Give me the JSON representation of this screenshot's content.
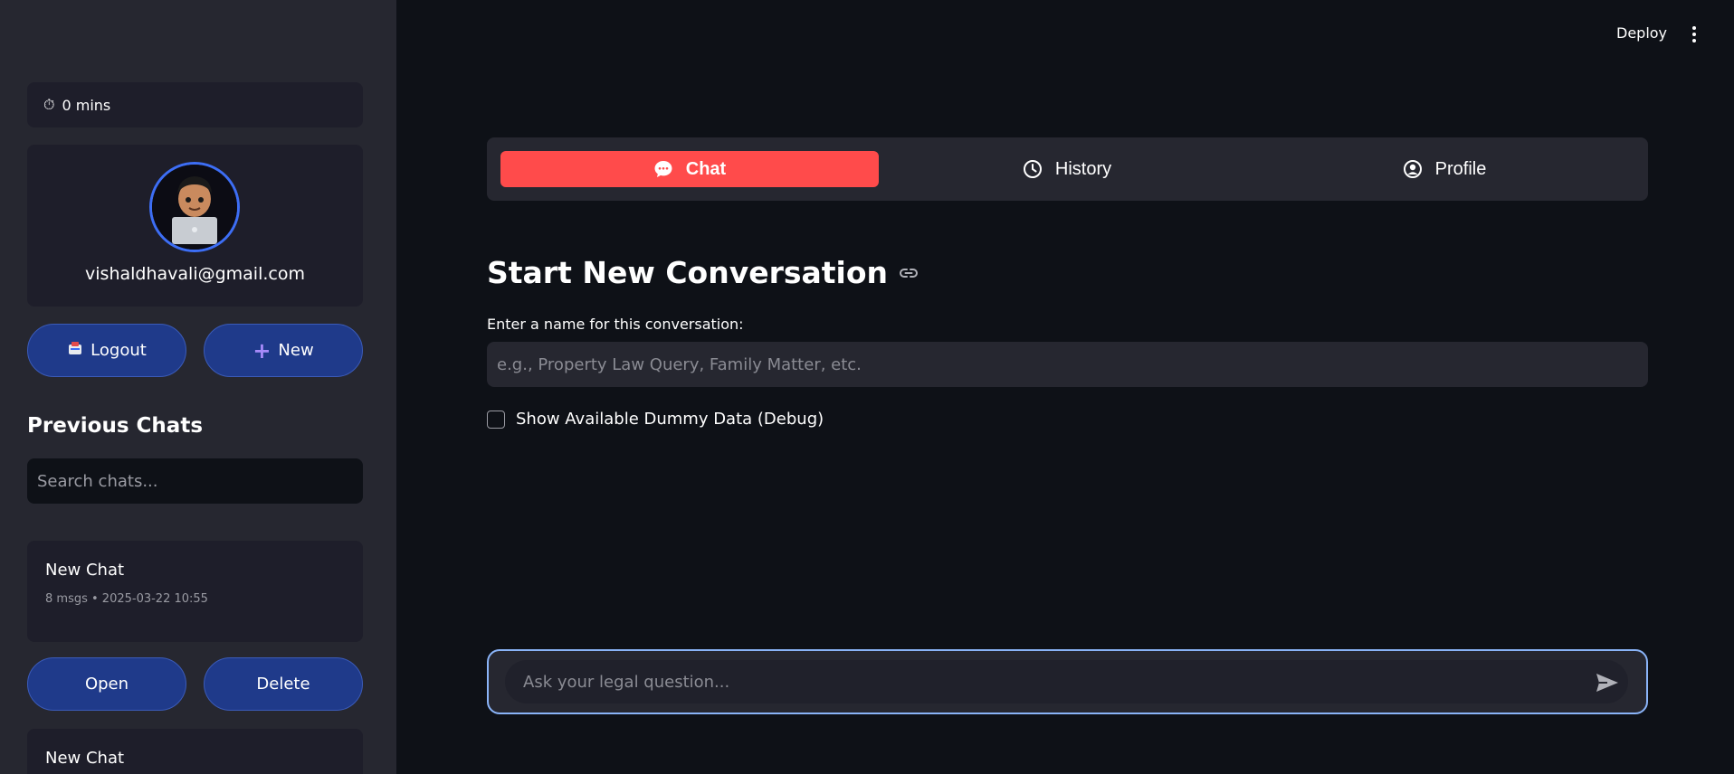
{
  "sidebar": {
    "timer": {
      "icon": "stopwatch-icon",
      "text": "0 mins"
    },
    "profile": {
      "email": "vishaldhavali@gmail.com"
    },
    "buttons": {
      "logout": "Logout",
      "new": "New"
    },
    "previous_chats_title": "Previous Chats",
    "search_placeholder": "Search chats...",
    "chats": [
      {
        "title": "New Chat",
        "meta": "8 msgs • 2025-03-22 10:55"
      },
      {
        "title": "New Chat"
      }
    ],
    "chat_actions": {
      "open": "Open",
      "delete": "Delete"
    }
  },
  "header": {
    "deploy": "Deploy"
  },
  "tabs": [
    {
      "label": "Chat",
      "icon": "chat-bubble-icon",
      "active": true
    },
    {
      "label": "History",
      "icon": "clock-icon",
      "active": false
    },
    {
      "label": "Profile",
      "icon": "user-circle-icon",
      "active": false
    }
  ],
  "main": {
    "title": "Start New Conversation",
    "name_label": "Enter a name for this conversation:",
    "name_placeholder": "e.g., Property Law Query, Family Matter, etc.",
    "debug_checkbox_label": "Show Available Dummy Data (Debug)",
    "chat_placeholder": "Ask your legal question..."
  },
  "colors": {
    "accent": "#ff4b4b",
    "button": "#1f3a8a",
    "focus": "#8ab4f8"
  }
}
